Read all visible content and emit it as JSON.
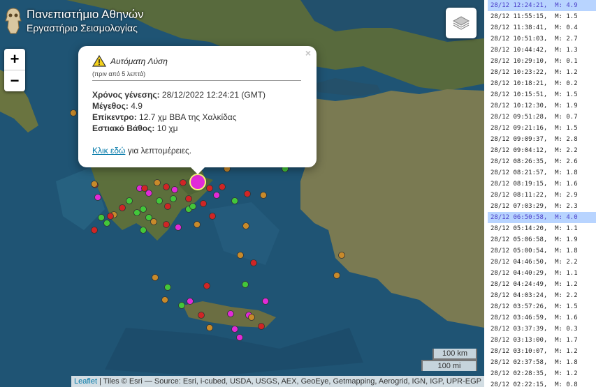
{
  "header": {
    "line1": "Πανεπιστήμιο Αθηνών",
    "line2": "Εργαστήριο Σεισμολογίας",
    "logo_icon": "owl-logo-icon"
  },
  "zoom": {
    "in_label": "+",
    "out_label": "−"
  },
  "layers_icon": "layers-icon",
  "popup": {
    "title": "Αυτόματη Λύση",
    "subtitle": "(πριν από 5 λεπτά)",
    "close": "×",
    "fields": [
      {
        "label": "Χρόνος γένεσης:",
        "value": "28/12/2022 12:24:21 (GMT)"
      },
      {
        "label": "Μέγεθος:",
        "value": "4.9"
      },
      {
        "label": "Επίκεντρο:",
        "value": "12.7 χμ ΒΒΑ της Χαλκίδας"
      },
      {
        "label": "Εστιακό Βάθος:",
        "value": "10 χμ"
      }
    ],
    "link_text": "Κλικ εδώ",
    "link_suffix": " για λεπτομέρειες."
  },
  "scale": {
    "km": "100 km",
    "mi": "100 mi"
  },
  "attribution": {
    "leaflet": "Leaflet",
    "text": " | Tiles © Esri — Source: Esri, i-cubed, USDA, USGS, AEX, GeoEye, Getmapping, Aerogrid, IGN, IGP, UPR-EGP"
  },
  "colors": {
    "sea": "#1d4f6e",
    "land": "#5a6e3e",
    "quake_green": "#42c73a",
    "quake_red": "#d02525",
    "quake_magenta": "#e22ad8",
    "quake_orange": "#c88a2a",
    "list_highlight": "#b8d4ff",
    "link": "#0078a8"
  },
  "events": [
    {
      "time": "28/12 12:24:21,",
      "mag": "M: 4.9",
      "selected": true
    },
    {
      "time": "28/12 11:55:15,",
      "mag": "M: 1.5"
    },
    {
      "time": "28/12 11:38:41,",
      "mag": "M: 0.4"
    },
    {
      "time": "28/12 10:51:03,",
      "mag": "M: 2.7"
    },
    {
      "time": "28/12 10:44:42,",
      "mag": "M: 1.3"
    },
    {
      "time": "28/12 10:29:10,",
      "mag": "M: 0.1"
    },
    {
      "time": "28/12 10:23:22,",
      "mag": "M: 1.2"
    },
    {
      "time": "28/12 10:18:21,",
      "mag": "M: 0.2"
    },
    {
      "time": "28/12 10:15:51,",
      "mag": "M: 1.5"
    },
    {
      "time": "28/12 10:12:30,",
      "mag": "M: 1.9"
    },
    {
      "time": "28/12 09:51:28,",
      "mag": "M: 0.7"
    },
    {
      "time": "28/12 09:21:16,",
      "mag": "M: 1.5"
    },
    {
      "time": "28/12 09:09:37,",
      "mag": "M: 2.8"
    },
    {
      "time": "28/12 09:04:12,",
      "mag": "M: 2.2"
    },
    {
      "time": "28/12 08:26:35,",
      "mag": "M: 2.6"
    },
    {
      "time": "28/12 08:21:57,",
      "mag": "M: 1.8"
    },
    {
      "time": "28/12 08:19:15,",
      "mag": "M: 1.6"
    },
    {
      "time": "28/12 08:11:22,",
      "mag": "M: 2.9"
    },
    {
      "time": "28/12 07:03:29,",
      "mag": "M: 2.3"
    },
    {
      "time": "28/12 06:50:58,",
      "mag": "M: 4.0",
      "selected": true
    },
    {
      "time": "28/12 05:14:20,",
      "mag": "M: 1.1"
    },
    {
      "time": "28/12 05:06:58,",
      "mag": "M: 1.9"
    },
    {
      "time": "28/12 05:00:54,",
      "mag": "M: 1.8"
    },
    {
      "time": "28/12 04:46:50,",
      "mag": "M: 2.2"
    },
    {
      "time": "28/12 04:40:29,",
      "mag": "M: 1.1"
    },
    {
      "time": "28/12 04:24:49,",
      "mag": "M: 1.2"
    },
    {
      "time": "28/12 04:03:24,",
      "mag": "M: 2.2"
    },
    {
      "time": "28/12 03:57:26,",
      "mag": "M: 1.5"
    },
    {
      "time": "28/12 03:46:59,",
      "mag": "M: 1.6"
    },
    {
      "time": "28/12 03:37:39,",
      "mag": "M: 0.3"
    },
    {
      "time": "28/12 03:13:00,",
      "mag": "M: 1.7"
    },
    {
      "time": "28/12 03:10:07,",
      "mag": "M: 1.2"
    },
    {
      "time": "28/12 02:37:58,",
      "mag": "M: 1.8"
    },
    {
      "time": "28/12 02:28:35,",
      "mag": "M: 1.2"
    },
    {
      "time": "28/12 02:22:15,",
      "mag": "M: 0.8"
    }
  ]
}
